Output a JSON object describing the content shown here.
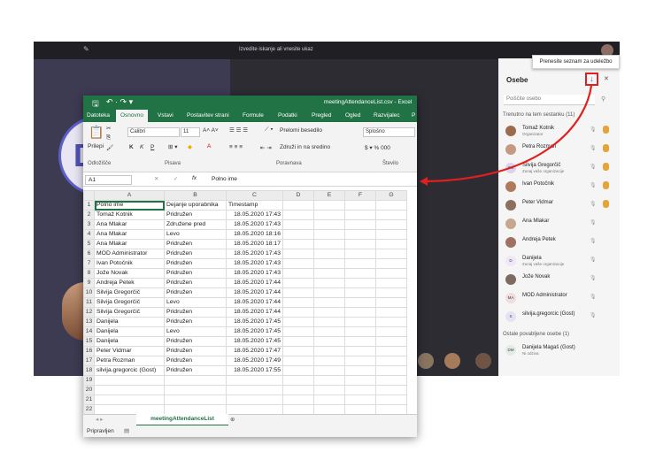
{
  "colors": {
    "excel_green": "#217346",
    "teams_purple": "#5b5fc7",
    "highlight_red": "#e01f1f"
  },
  "teams": {
    "search_text": "Izvedite iskanje ali vnesite ukaz",
    "avatar_initial": "D"
  },
  "tooltip": "Prenesite seznam za udeležbo",
  "people": {
    "title": "Osebe",
    "search_placeholder": "Poiščite osebo",
    "section_in_meeting": "Trenutno na tem sestanku (11)",
    "section_other": "Ostale povabljene osebe (1)",
    "members": [
      {
        "name": "Tomaž Kotnik",
        "sub": "Organizator",
        "initials": ""
      },
      {
        "name": "Petra Rozman",
        "sub": "",
        "initials": ""
      },
      {
        "name": "Silvija Gregorčič",
        "sub": "Zunaj vaše organizacije",
        "initials": "SG"
      },
      {
        "name": "Ivan Potočnik",
        "sub": "",
        "initials": ""
      },
      {
        "name": "Peter Vidmar",
        "sub": "",
        "initials": ""
      },
      {
        "name": "Ana Mlakar",
        "sub": "",
        "initials": ""
      },
      {
        "name": "Andreja Petek",
        "sub": "",
        "initials": ""
      },
      {
        "name": "Danijela",
        "sub": "Zunaj vaše organizacije",
        "initials": "D"
      },
      {
        "name": "Jože Novak",
        "sub": "",
        "initials": ""
      },
      {
        "name": "MOD Administrator",
        "sub": "",
        "initials": "MA"
      },
      {
        "name": "silvija.gregorcic (Gost)",
        "sub": "",
        "initials": "S"
      }
    ],
    "other": [
      {
        "name": "Danijela Magaš (Gost)",
        "sub": "Ni odziva",
        "initials": "DM"
      }
    ]
  },
  "excel": {
    "filename": "meetingAttendanceList.csv - Excel",
    "tabs": [
      "Datoteka",
      "Osnovno",
      "Vstavi",
      "Postavitev strani",
      "Formule",
      "Podatki",
      "Pregled",
      "Ogled",
      "Razvijalec",
      "P"
    ],
    "font_name": "Calibri",
    "font_size": "11",
    "wrap_label": "Prelomi besedilo",
    "merge_label": "Združi in na sredino",
    "number_format": "Splošno",
    "paste_label": "Prilepi",
    "clipboard_group": "Odložišče",
    "font_group": "Pisava",
    "align_group": "Poravnava",
    "number_group": "Število",
    "name_box": "A1",
    "formula_value": "Polno ime",
    "columns": [
      "A",
      "B",
      "C",
      "D",
      "E",
      "F",
      "G"
    ],
    "rows": [
      [
        "Polno ime",
        "Dejanje uporabnika",
        "Timestamp"
      ],
      [
        "Tomaž Kotnik",
        "Pridružen",
        "18.05.2020 17:43"
      ],
      [
        "Ana Mlakar",
        "Združene pred",
        "18.05.2020 17:43"
      ],
      [
        "Ana Mlakar",
        "Levo",
        "18.05.2020 18:16"
      ],
      [
        "Ana Mlakar",
        "Pridružen",
        "18.05.2020 18:17"
      ],
      [
        "MOD Administrator",
        "Pridružen",
        "18.05.2020 17:43"
      ],
      [
        "Ivan Potočnik",
        "Pridružen",
        "18.05.2020 17:43"
      ],
      [
        "Jože Novak",
        "Pridružen",
        "18.05.2020 17:43"
      ],
      [
        "Andreja Petek",
        "Pridružen",
        "18.05.2020 17:44"
      ],
      [
        "Silvija Gregorčič",
        "Pridružen",
        "18.05.2020 17:44"
      ],
      [
        "Silvija Gregorčič",
        "Levo",
        "18.05.2020 17:44"
      ],
      [
        "Silvija Gregorčič",
        "Pridružen",
        "18.05.2020 17:44"
      ],
      [
        "Danijela",
        "Pridružen",
        "18.05.2020 17:45"
      ],
      [
        "Danijela",
        "Levo",
        "18.05.2020 17:45"
      ],
      [
        "Danijela",
        "Pridružen",
        "18.05.2020 17:45"
      ],
      [
        "Peter Vidmar",
        "Pridružen",
        "18.05.2020 17:47"
      ],
      [
        "Petra Rozman",
        "Pridružen",
        "18.05.2020 17:49"
      ],
      [
        "silvija.gregorcic (Gost)",
        "Pridružen",
        "18.05.2020 17:55"
      ],
      [
        "",
        "",
        ""
      ],
      [
        "",
        "",
        ""
      ],
      [
        "",
        "",
        ""
      ],
      [
        "",
        "",
        ""
      ]
    ],
    "sheet_tab": "meetingAttendanceList",
    "status": "Pripravljen"
  }
}
